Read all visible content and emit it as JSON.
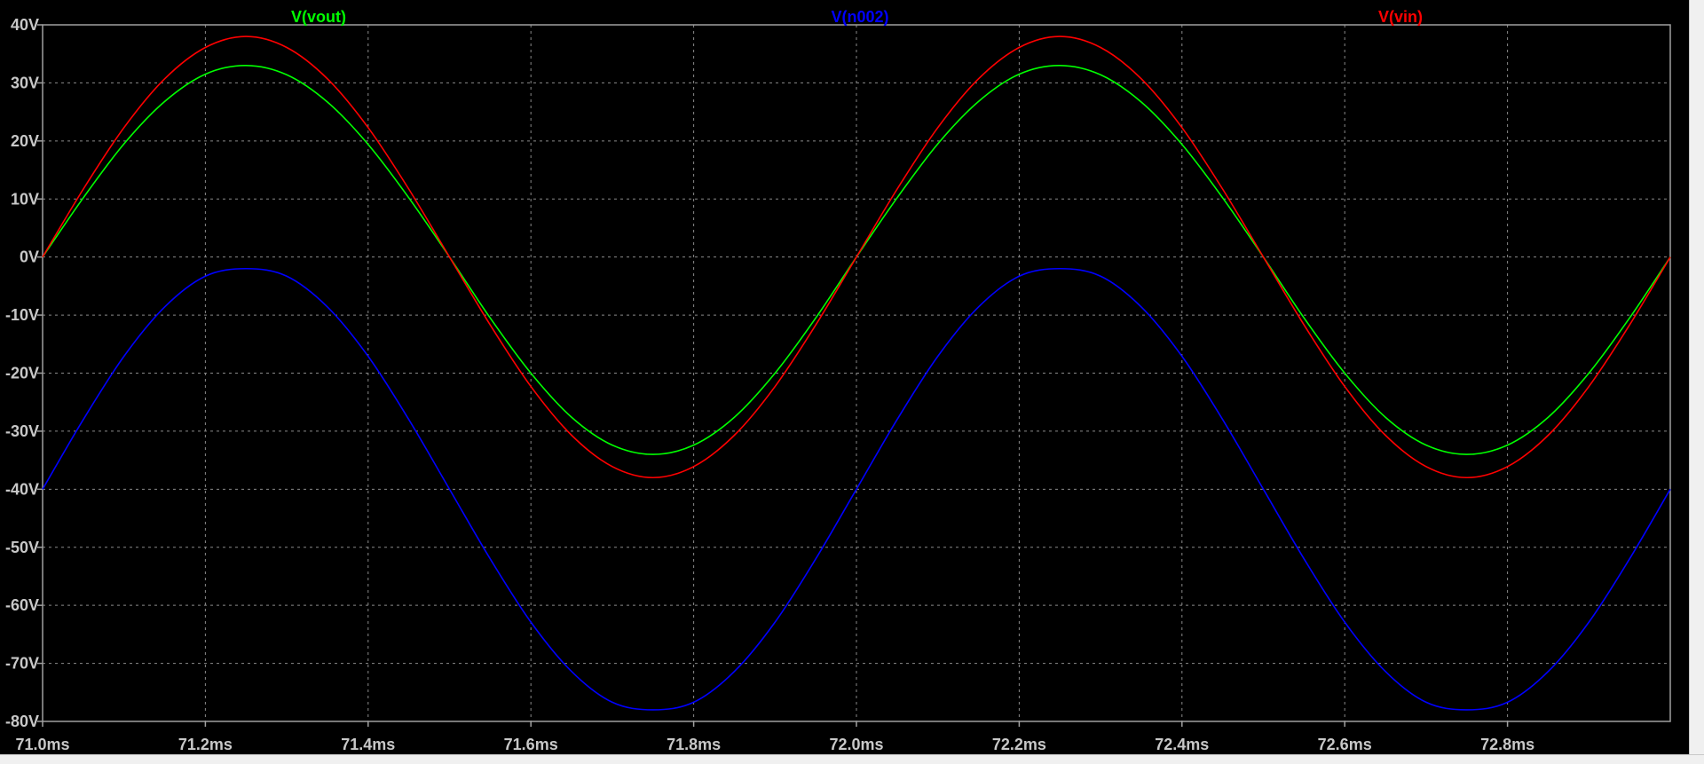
{
  "window": {
    "background_color": "#000000",
    "frame_color": "#f0f0f0"
  },
  "chart_data": {
    "type": "line",
    "xlabel": "",
    "ylabel": "",
    "xlim": [
      71.0,
      73.0
    ],
    "ylim": [
      -80,
      40
    ],
    "x_unit": "ms",
    "y_unit": "V",
    "grid": true,
    "grid_color": "#8a8a8a",
    "axis_color": "#a0a0a0",
    "tick_label_color": "#c8c8c8",
    "legend_placement": "top",
    "x_ticks": [
      71.0,
      71.2,
      71.4,
      71.6,
      71.8,
      72.0,
      72.2,
      72.4,
      72.6,
      72.8
    ],
    "x_tick_labels": [
      "71.0ms",
      "71.2ms",
      "71.4ms",
      "71.6ms",
      "71.8ms",
      "72.0ms",
      "72.2ms",
      "72.4ms",
      "72.6ms",
      "72.8ms"
    ],
    "y_ticks": [
      40,
      30,
      20,
      10,
      0,
      -10,
      -20,
      -30,
      -40,
      -50,
      -60,
      -70,
      -80
    ],
    "y_tick_labels": [
      "40V",
      "30V",
      "20V",
      "10V",
      "0V",
      "-10V",
      "-20V",
      "-30V",
      "-40V",
      "-50V",
      "-60V",
      "-70V",
      "-80V"
    ],
    "x_sample": [
      71.0,
      71.05,
      71.1,
      71.15,
      71.2,
      71.25,
      71.3,
      71.35,
      71.4,
      71.45,
      71.5,
      71.55,
      71.6,
      71.65,
      71.7,
      71.75,
      71.8,
      71.85,
      71.9,
      71.95,
      72.0,
      72.05,
      72.1,
      72.15,
      72.2,
      72.25,
      72.3,
      72.35,
      72.4,
      72.45,
      72.5,
      72.55,
      72.6,
      72.65,
      72.7,
      72.75,
      72.8,
      72.85,
      72.9,
      72.95,
      73.0
    ],
    "series": [
      {
        "name": "V(vout)",
        "color": "#00ff00",
        "values": [
          0.0,
          10.2,
          19.5,
          26.8,
          31.5,
          33.0,
          31.4,
          26.7,
          19.4,
          10.2,
          0.0,
          -10.5,
          -20.0,
          -27.6,
          -32.4,
          -34.0,
          -32.4,
          -27.6,
          -20.0,
          -10.5,
          0.0,
          10.2,
          19.5,
          26.8,
          31.5,
          33.0,
          31.4,
          26.7,
          19.4,
          10.2,
          0.0,
          -10.5,
          -20.0,
          -27.6,
          -32.4,
          -34.0,
          -32.4,
          -27.6,
          -20.0,
          -10.5,
          0.0
        ]
      },
      {
        "name": "V(n002)",
        "color": "#0000ff",
        "values": [
          -40.0,
          -28.0,
          -17.1,
          -8.6,
          -3.3,
          -2.0,
          -3.3,
          -8.6,
          -17.1,
          -28.0,
          -40.0,
          -52.0,
          -62.9,
          -71.4,
          -76.7,
          -78.0,
          -76.7,
          -71.4,
          -62.9,
          -52.0,
          -40.0,
          -28.0,
          -17.1,
          -8.6,
          -3.3,
          -2.0,
          -3.3,
          -8.6,
          -17.1,
          -28.0,
          -40.0,
          -52.0,
          -62.9,
          -71.4,
          -76.7,
          -78.0,
          -76.7,
          -71.4,
          -62.9,
          -52.0,
          -40.0
        ]
      },
      {
        "name": "V(vin)",
        "color": "#ff0000",
        "values": [
          0.0,
          11.7,
          22.3,
          30.7,
          36.1,
          38.0,
          36.1,
          30.7,
          22.3,
          11.7,
          0.0,
          -11.7,
          -22.3,
          -30.7,
          -36.1,
          -38.0,
          -36.1,
          -30.7,
          -22.3,
          -11.7,
          0.0,
          11.7,
          22.3,
          30.7,
          36.1,
          38.0,
          36.1,
          30.7,
          22.3,
          11.7,
          0.0,
          -11.7,
          -22.3,
          -30.7,
          -36.1,
          -38.0,
          -36.1,
          -30.7,
          -22.3,
          -11.7,
          0.0
        ]
      }
    ]
  }
}
